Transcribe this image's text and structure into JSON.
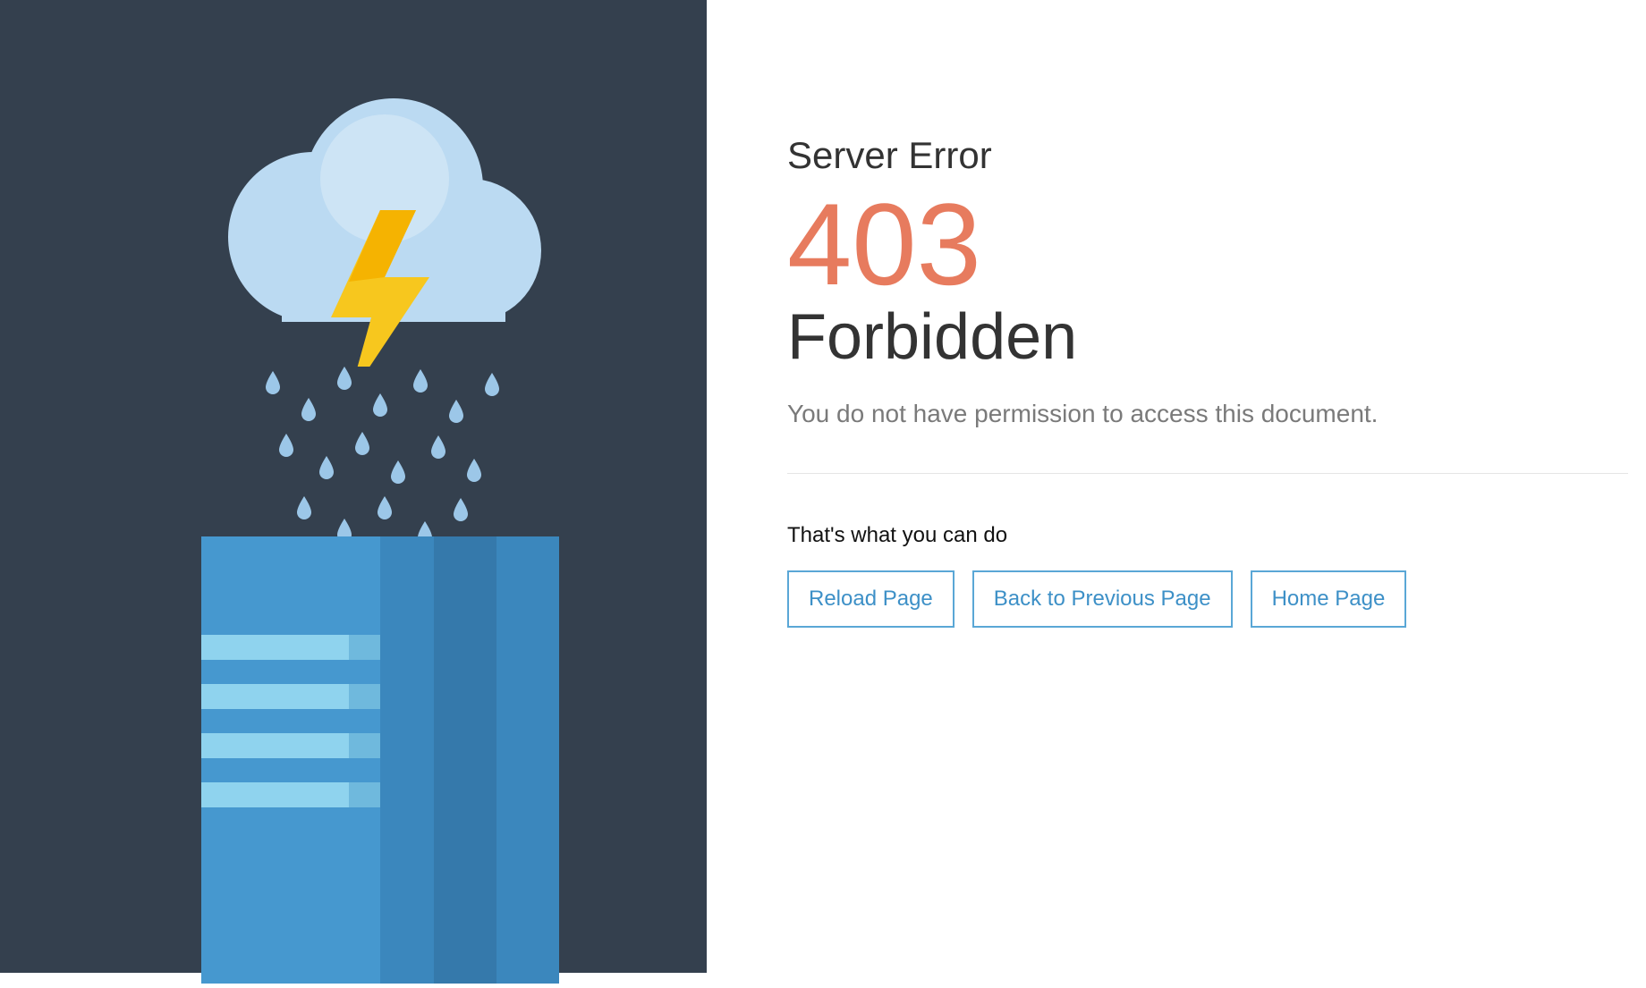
{
  "error": {
    "label": "Server Error",
    "code": "403",
    "title": "Forbidden",
    "description": "You do not have permission to access this document."
  },
  "help": {
    "label": "That's what you can do",
    "buttons": [
      {
        "label": "Reload Page"
      },
      {
        "label": "Back to Previous Page"
      },
      {
        "label": "Home Page"
      }
    ]
  },
  "colors": {
    "dark_bg": "#34404e",
    "accent": "#e77b5e",
    "button_border": "#5aa7d6",
    "button_text": "#3d90c7"
  }
}
